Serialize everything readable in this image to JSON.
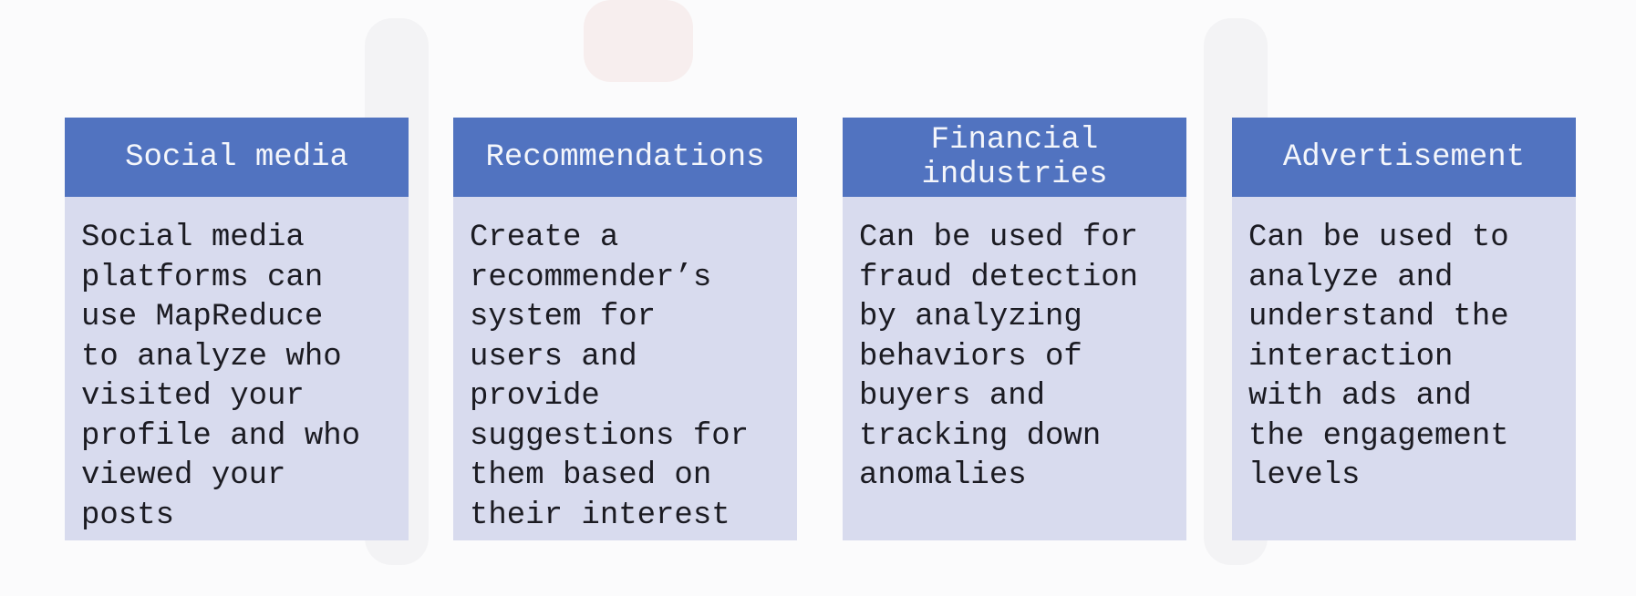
{
  "cards": [
    {
      "title": [
        "Social media"
      ],
      "lines": [
        "Social media",
        "platforms can",
        "use MapReduce",
        "to analyze who",
        "visited your",
        "profile and who",
        "viewed your",
        "posts"
      ]
    },
    {
      "title": [
        "Recommendations"
      ],
      "lines": [
        "Create a",
        "recommender’s",
        "system for",
        "users and",
        "provide",
        "suggestions for",
        "them based on",
        "their interest"
      ]
    },
    {
      "title": [
        "Financial",
        "industries"
      ],
      "lines": [
        "Can be used for",
        "fraud detection",
        "by analyzing",
        "behaviors of",
        "buyers and",
        "tracking down",
        "anomalies"
      ]
    },
    {
      "title": [
        "Advertisement"
      ],
      "lines": [
        "Can be used to",
        "analyze and",
        "understand the",
        "interaction",
        "with ads and",
        "the engagement",
        "levels"
      ]
    }
  ]
}
